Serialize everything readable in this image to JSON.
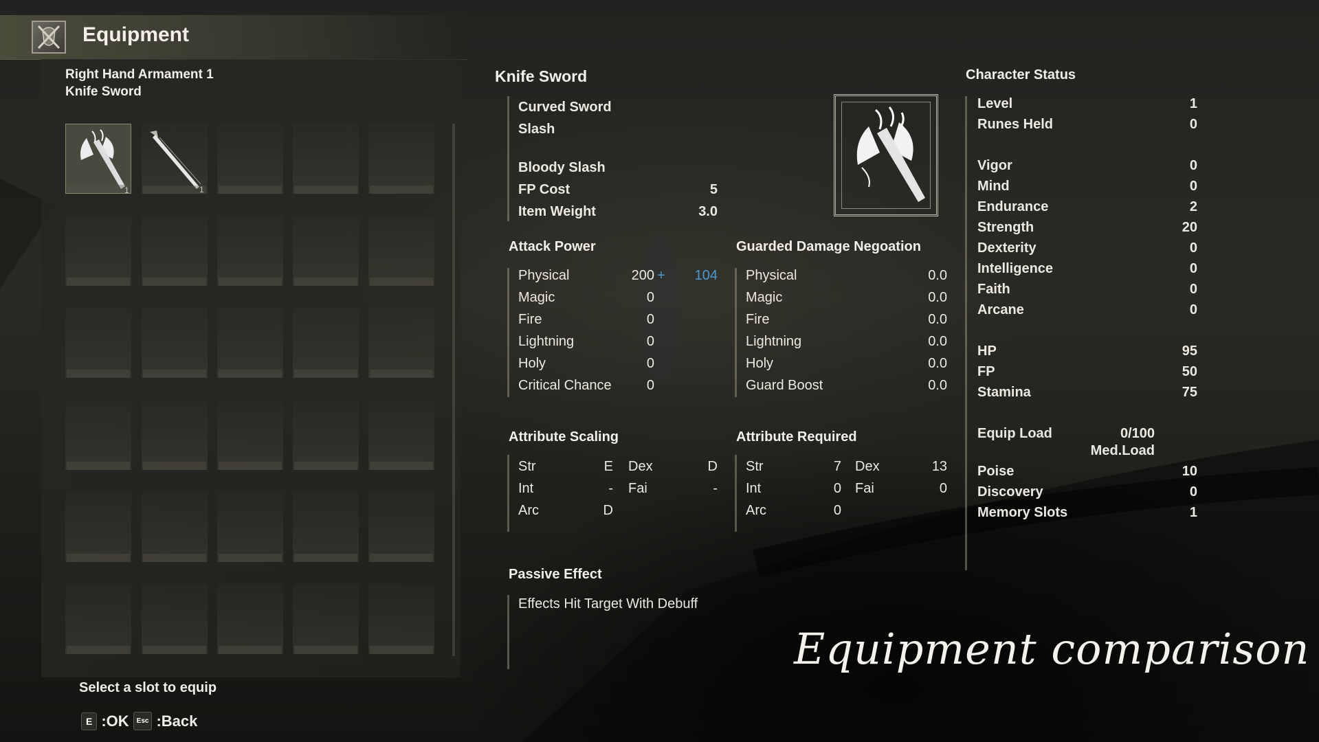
{
  "header": {
    "title": "Equipment",
    "icon": "crossed-swords-shield-icon"
  },
  "slot": {
    "line1": "Right Hand Armament 1",
    "line2": "Knife Sword"
  },
  "inventory": {
    "items": [
      {
        "name": "axe-item-icon",
        "count": "1"
      },
      {
        "name": "knife-sword-item-icon",
        "count": "1"
      }
    ]
  },
  "footer": {
    "hint": "Select a slot to equip",
    "ok_key": "E",
    "ok_label": ":OK",
    "back_key": "Esc",
    "back_label": ":Back"
  },
  "weapon": {
    "name": "Knife Sword",
    "type": "Curved Sword",
    "damage_type": "Slash",
    "skill": "Bloody Slash",
    "fp_cost_label": "FP Cost",
    "fp_cost": "5",
    "weight_label": "Item Weight",
    "weight": "3.0"
  },
  "attack_power": {
    "title": "Attack Power",
    "rows": [
      {
        "label": "Physical",
        "value": "200",
        "plus": "+",
        "bonus": "104"
      },
      {
        "label": "Magic",
        "value": "0"
      },
      {
        "label": "Fire",
        "value": "0"
      },
      {
        "label": "Lightning",
        "value": "0"
      },
      {
        "label": "Holy",
        "value": "0"
      },
      {
        "label": "Critical Chance",
        "value": "0"
      }
    ]
  },
  "guarded": {
    "title": "Guarded Damage Negoation",
    "rows": [
      {
        "label": "Physical",
        "value": "0.0"
      },
      {
        "label": "Magic",
        "value": "0.0"
      },
      {
        "label": "Fire",
        "value": "0.0"
      },
      {
        "label": "Lightning",
        "value": "0.0"
      },
      {
        "label": "Holy",
        "value": "0.0"
      },
      {
        "label": "Guard Boost",
        "value": "0.0"
      }
    ]
  },
  "scaling": {
    "title": "Attribute Scaling",
    "str_label": "Str",
    "str": "E",
    "dex_label": "Dex",
    "dex": "D",
    "int_label": "Int",
    "int": "-",
    "fai_label": "Fai",
    "fai": "-",
    "arc_label": "Arc",
    "arc": "D"
  },
  "required": {
    "title": "Attribute Required",
    "str_label": "Str",
    "str": "7",
    "dex_label": "Dex",
    "dex": "13",
    "int_label": "Int",
    "int": "0",
    "fai_label": "Fai",
    "fai": "0",
    "arc_label": "Arc",
    "arc": "0"
  },
  "passive": {
    "title": "Passive Effect",
    "text": "Effects Hit Target With Debuff"
  },
  "status": {
    "title": "Character Status",
    "level_label": "Level",
    "level": "1",
    "runes_label": "Runes Held",
    "runes": "0",
    "attrs": [
      {
        "label": "Vigor",
        "value": "0"
      },
      {
        "label": "Mind",
        "value": "0"
      },
      {
        "label": "Endurance",
        "value": "2"
      },
      {
        "label": "Strength",
        "value": "20"
      },
      {
        "label": "Dexterity",
        "value": "0"
      },
      {
        "label": "Intelligence",
        "value": "0"
      },
      {
        "label": "Faith",
        "value": "0"
      },
      {
        "label": "Arcane",
        "value": "0"
      }
    ],
    "hp_label": "HP",
    "hp": "95",
    "fp_label": "FP",
    "fp": "50",
    "stamina_label": "Stamina",
    "stamina": "75",
    "equip_load_label": "Equip Load",
    "equip_load": "0/100",
    "equip_load_class": "Med.Load",
    "poise_label": "Poise",
    "poise": "10",
    "discovery_label": "Discovery",
    "discovery": "0",
    "memory_label": "Memory Slots",
    "memory": "1"
  },
  "caption": "Equipment comparison",
  "colors": {
    "accent_blue": "#4a9ad6",
    "text": "#ece9e0",
    "panel": "#2a2a25"
  }
}
